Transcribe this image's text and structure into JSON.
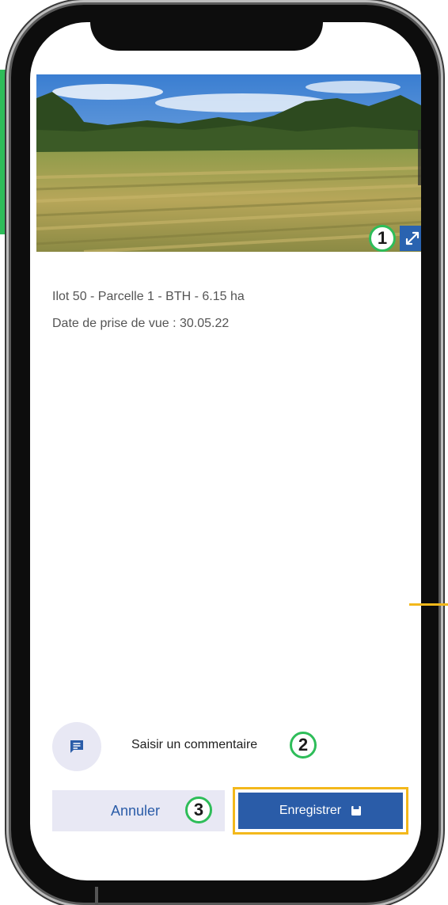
{
  "photo": {
    "alt": "Field photo"
  },
  "parcel": {
    "title": "Ilot 50 - Parcelle 1 - BTH - 6.15 ha",
    "date": "Date de prise de vue : 30.05.22"
  },
  "comment": {
    "label": "Saisir un commentaire"
  },
  "actions": {
    "cancel_label": "Annuler",
    "save_label": "Enregistrer"
  },
  "annotations": {
    "badge_1": "1",
    "badge_2": "2",
    "badge_3": "3"
  },
  "icons": {
    "expand": "expand-icon",
    "comment": "comment-icon",
    "save": "save-icon"
  },
  "colors": {
    "primary": "#2a5ca8",
    "annotation_green": "#2ebd59",
    "highlight_yellow": "#f3b81b",
    "button_light": "#e8e8f4"
  }
}
